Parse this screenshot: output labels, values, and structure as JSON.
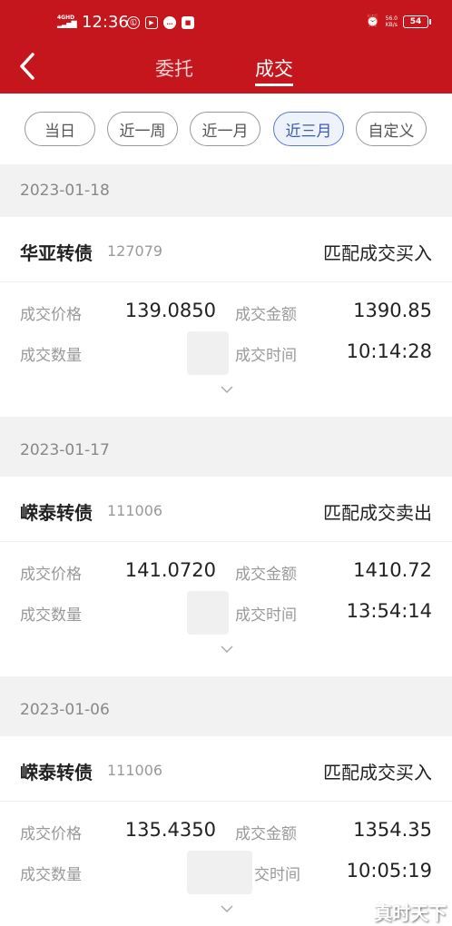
{
  "status_bar": {
    "network": "4GHD",
    "time": "12:36",
    "netspeed_value": "56.0",
    "netspeed_unit": "KB/s",
    "battery": "54"
  },
  "header": {
    "tabs": [
      {
        "label": "委托",
        "active": false
      },
      {
        "label": "成交",
        "active": true
      }
    ]
  },
  "filters": [
    {
      "label": "当日",
      "active": false
    },
    {
      "label": "近一周",
      "active": false
    },
    {
      "label": "近一月",
      "active": false
    },
    {
      "label": "近三月",
      "active": true
    },
    {
      "label": "自定义",
      "active": false
    }
  ],
  "field_labels": {
    "price": "成交价格",
    "amount": "成交金额",
    "quantity": "成交数量",
    "time": "成交时间",
    "time_partial": "交时间"
  },
  "trades": [
    {
      "date": "2023-01-18",
      "name": "华亚转债",
      "code": "127079",
      "type": "匹配成交买入",
      "price": "139.0850",
      "amount": "1390.85",
      "time": "10:14:28"
    },
    {
      "date": "2023-01-17",
      "name": "嵘泰转债",
      "code": "111006",
      "type": "匹配成交卖出",
      "price": "141.0720",
      "amount": "1410.72",
      "time": "13:54:14"
    },
    {
      "date": "2023-01-06",
      "name": "嵘泰转债",
      "code": "111006",
      "type": "匹配成交买入",
      "price": "135.4350",
      "amount": "1354.35",
      "time": "10:05:19"
    }
  ],
  "watermark": "真时天下",
  "colors": {
    "header_red": "#c4161c",
    "active_chip": "#3b5bb0"
  }
}
